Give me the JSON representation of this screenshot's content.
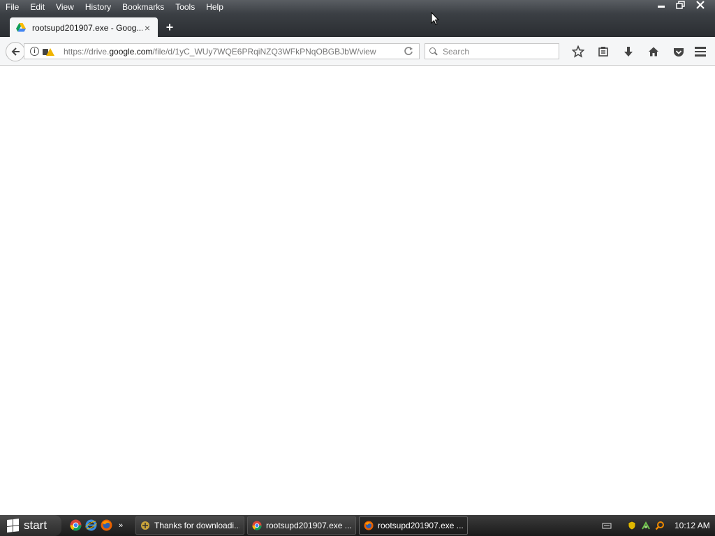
{
  "menubar": {
    "items": [
      "File",
      "Edit",
      "View",
      "History",
      "Bookmarks",
      "Tools",
      "Help"
    ]
  },
  "tab": {
    "title": "rootsupd201907.exe - Goog...",
    "close": "×"
  },
  "newtab": {
    "label": "+"
  },
  "urlbar": {
    "prefix": "https://drive.",
    "host": "google.com",
    "path": "/file/d/1yC_WUy7WQE6PRqiNZQ3WFkPNqOBGBJbW/view"
  },
  "search": {
    "placeholder": "Search"
  },
  "taskbar": {
    "start_label": "start",
    "tasks": [
      {
        "label": "Thanks for downloadi..."
      },
      {
        "label": "rootsupd201907.exe ..."
      },
      {
        "label": "rootsupd201907.exe ..."
      }
    ],
    "clock": "10:12 AM"
  },
  "colors": {
    "chrome_dark": "#2a2d31",
    "warning": "#f0b400"
  }
}
